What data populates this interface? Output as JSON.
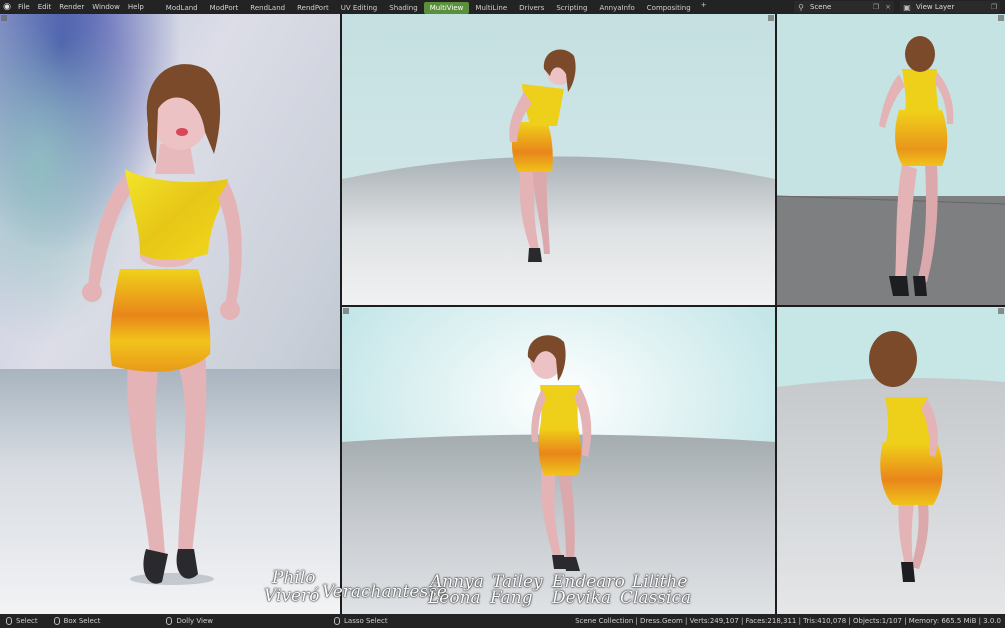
{
  "menu": [
    "File",
    "Edit",
    "Render",
    "Window",
    "Help"
  ],
  "workspaces": {
    "tabs": [
      "ModLand",
      "ModPort",
      "RendLand",
      "RendPort",
      "UV Editing",
      "Shading",
      "MultiView",
      "MultiLine",
      "Drivers",
      "Scripting",
      "AnnyaInfo",
      "Compositing"
    ],
    "active": "MultiView",
    "add_label": "+"
  },
  "scene": {
    "label": "Scene",
    "close": "×"
  },
  "view_layer": {
    "label": "View Layer"
  },
  "signatures": {
    "philo": "Philo",
    "viviro": "Viveró",
    "verachantesse": "Verachantesse",
    "annya": "Annya",
    "leona": "Leona",
    "tailey": "Tailey",
    "fang": "Fang",
    "endearo": "Endearo",
    "devika": "Devika",
    "lilithe": "Lilithe",
    "classica": "Classica"
  },
  "status": {
    "select": "Select",
    "box_select": "Box Select",
    "dolly_view": "Dolly View",
    "lasso_select": "Lasso Select",
    "stats": "Scene Collection | Dress.Geom | Verts:249,107 | Faces:218,311 | Tris:410,078 | Objects:1/107 | Memory: 665.5 MiB | 3.0.0"
  },
  "colors": {
    "active_tab": "#5a8f3c",
    "dress_yellow": "#f0d21a",
    "dress_orange": "#e8861a",
    "skin": "#e7b6b8",
    "hair": "#7a4a2a"
  }
}
